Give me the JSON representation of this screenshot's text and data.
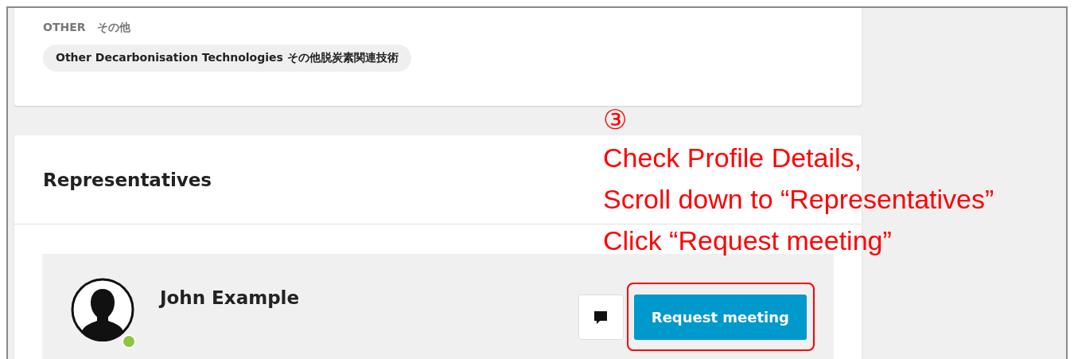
{
  "other_section": {
    "label": "OTHER　その他",
    "tags": [
      "Other Decarbonisation Technologies その他脱炭素関連技術"
    ]
  },
  "representatives": {
    "title": "Representatives",
    "people": [
      {
        "name": "John Example",
        "online": true,
        "action_button": "Request meeting"
      }
    ]
  },
  "annotation": {
    "step": "③",
    "lines": [
      "Check Profile Details,",
      "Scroll down to “Representatives”",
      "Click “Request meeting”"
    ]
  }
}
